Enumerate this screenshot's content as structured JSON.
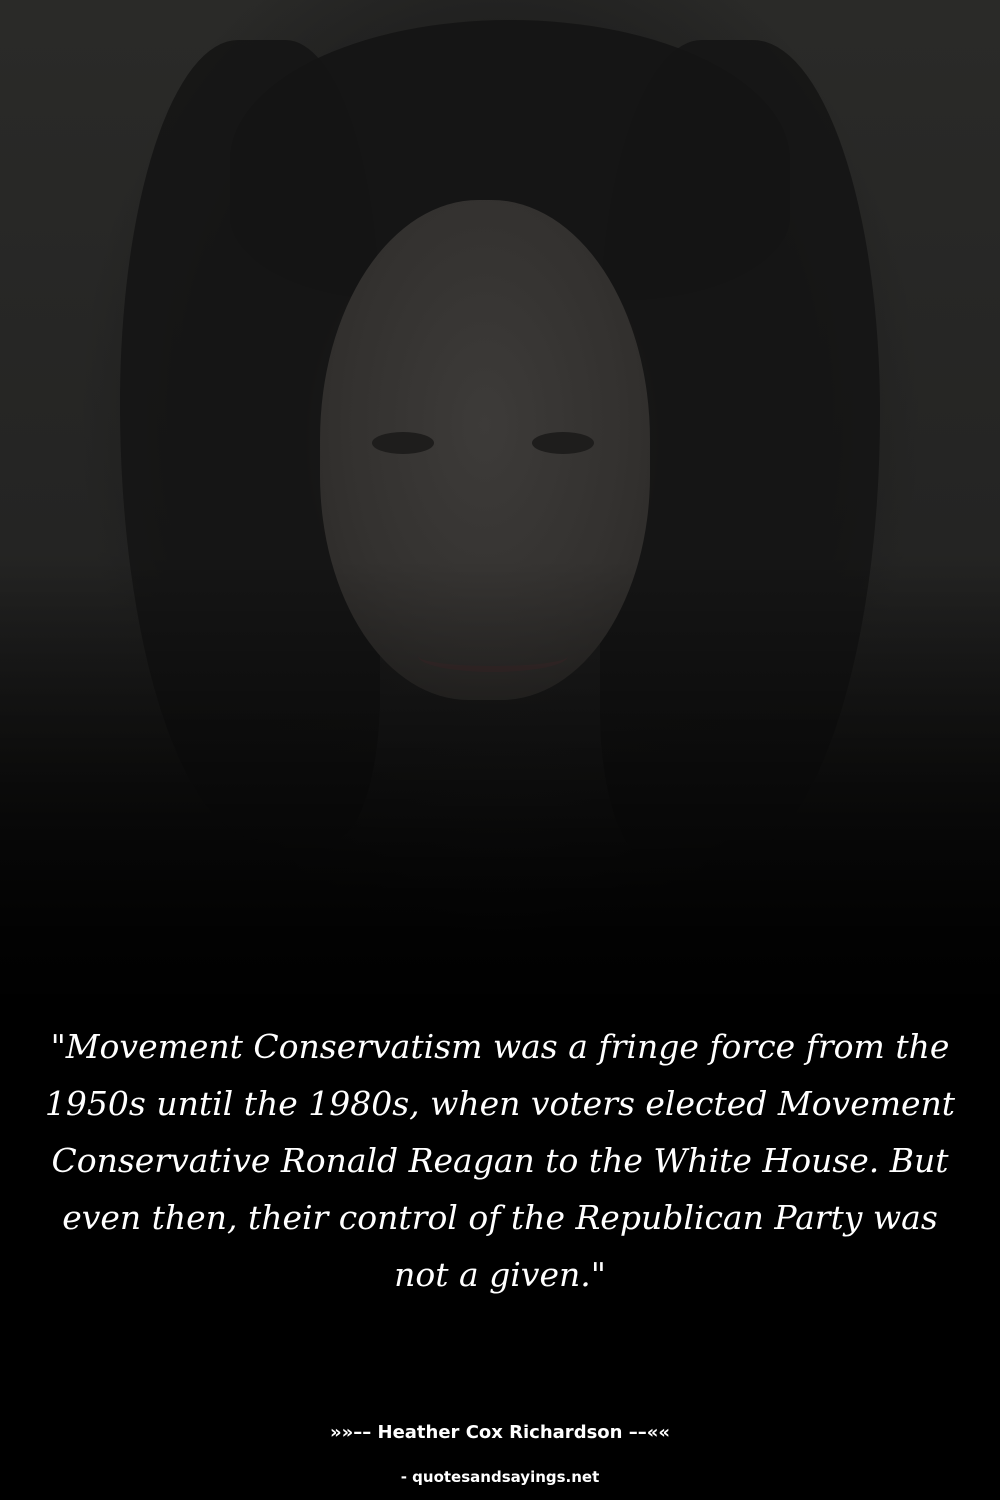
{
  "quote": {
    "text": "\"Movement Conservatism was a fringe force from the 1950s until the 1980s, when voters elected Movement Conservative Ronald Reagan to the White House. But even then, their control of the Republican Party was not a given.\""
  },
  "attribution": {
    "author_line": "»»–– Heather Cox Richardson ––««",
    "source_line": "- quotesandsayings.net"
  },
  "colors": {
    "background": "#000000",
    "text": "#ffffff"
  }
}
